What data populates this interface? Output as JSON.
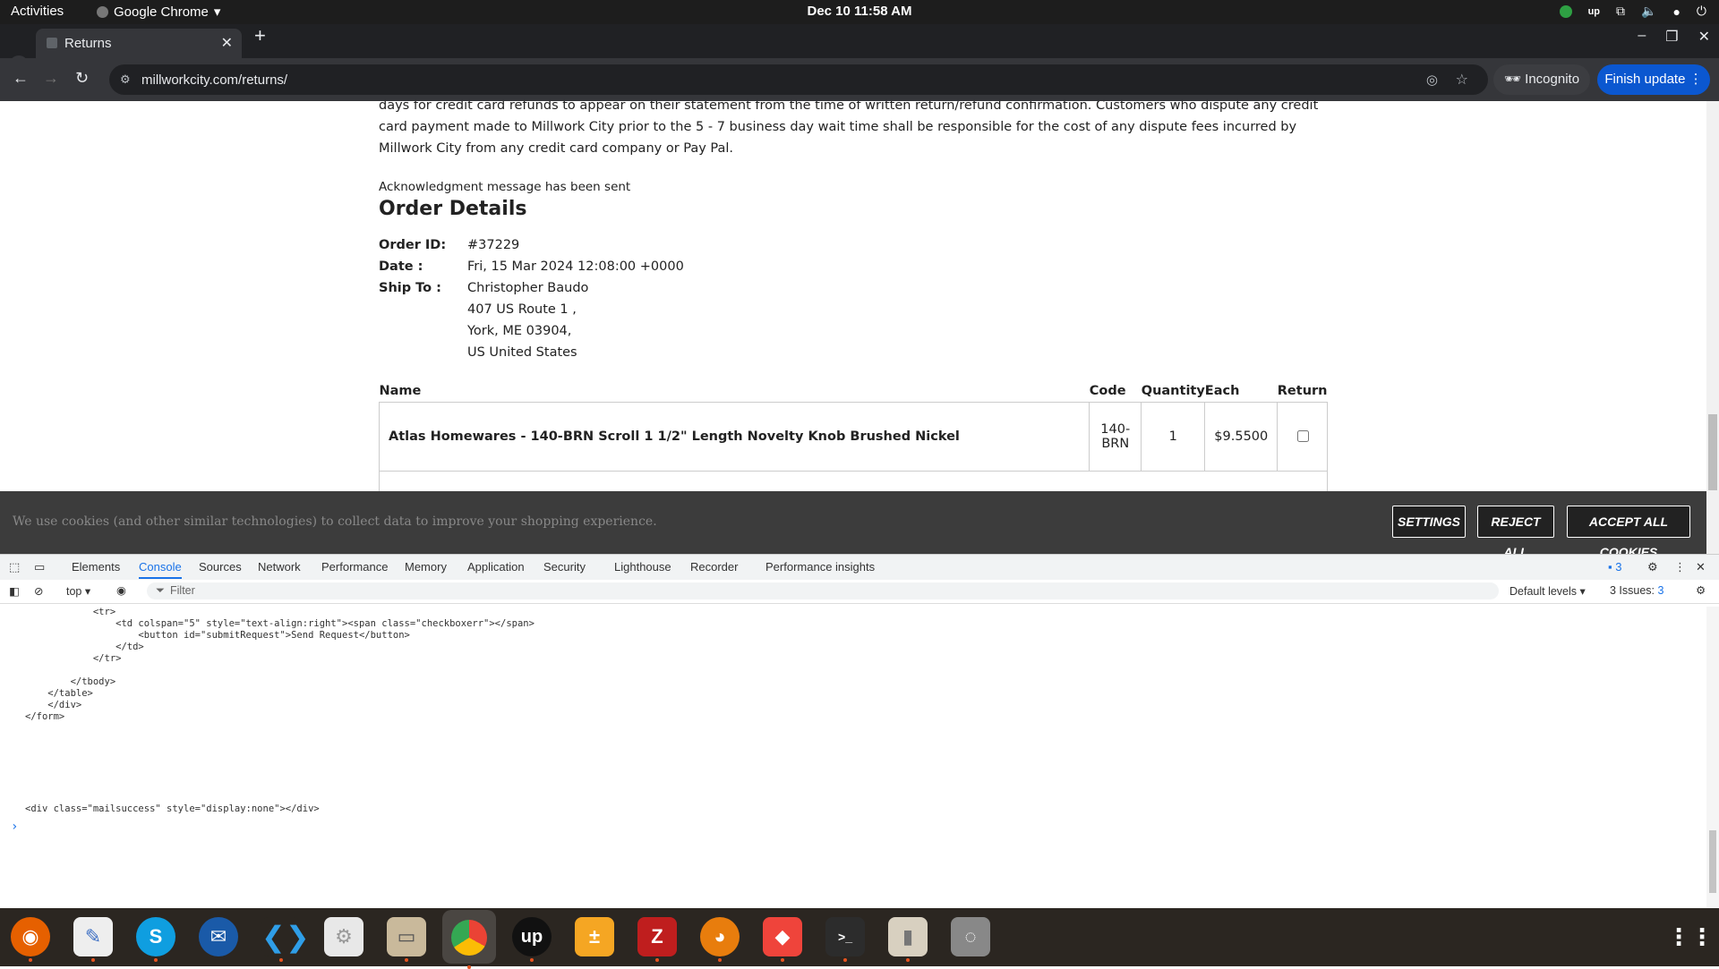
{
  "system": {
    "activities": "Activities",
    "app_name": "Google Chrome",
    "clock": "Dec 10  11:58 AM"
  },
  "browser": {
    "tab_title": "Returns",
    "url": "millworkcity.com/returns/",
    "incognito_label": "Incognito",
    "update_label": "Finish update"
  },
  "page": {
    "policy_text": "days for credit card refunds to appear on their statement from the time of written return/refund confirmation. Customers who dispute any credit card payment made to Millwork City prior to the 5 - 7 business day wait time shall be responsible for the cost of any dispute fees incurred by Millwork City from any credit card company or Pay Pal.",
    "ack_message": "Acknowledgment message has been sent",
    "heading": "Order Details",
    "order_id_label": "Order ID:",
    "order_id": "#37229",
    "date_label": "Date :",
    "date": "Fri, 15 Mar 2024 12:08:00 +0000",
    "ship_label": "Ship To :",
    "ship_name": "Christopher Baudo",
    "ship_addr1": "407 US Route 1 ,",
    "ship_addr2": "York, ME 03904,",
    "ship_country": "US United States",
    "table_headers": [
      "Name",
      "Code",
      "Quantity",
      "Each",
      "Return"
    ],
    "item": {
      "name": "Atlas Homewares - 140-BRN Scroll 1 1/2\" Length Novelty Knob Brushed Nickel",
      "code": "140-BRN",
      "quantity": "1",
      "each": "$9.5500"
    }
  },
  "cookie": {
    "message": "We use cookies (and other similar technologies) to collect data to improve your shopping experience.",
    "settings": "SETTINGS",
    "reject": "REJECT ALL",
    "accept": "ACCEPT ALL COOKIES"
  },
  "devtools": {
    "tabs": [
      "Elements",
      "Console",
      "Sources",
      "Network",
      "Performance",
      "Memory",
      "Application",
      "Security",
      "Lighthouse",
      "Recorder",
      "Performance insights"
    ],
    "active_tab": "Console",
    "context": "top",
    "filter_placeholder": "Filter",
    "levels": "Default levels",
    "issues": "3 Issues:",
    "issues_count": "3",
    "badge_count": "3",
    "console_code": "            <tr>\n                <td colspan=\"5\" style=\"text-align:right\"><span class=\"checkboxerr\"></span>\n                    <button id=\"submitRequest\">Send Request</button>\n                </td>\n            </tr>\n\n        </tbody>\n    </table>\n    </div>\n</form>",
    "console_line2": "<div class=\"mailsuccess\" style=\"display:none\"></div>",
    "prompt": "›"
  },
  "colors": {
    "chrome_dark": "#202124",
    "update_blue": "#0b57d0",
    "devtools_accent": "#1a73e8",
    "cookie_bg": "#3c3c3c"
  },
  "dock_icons": [
    "firefox-icon",
    "text-editor-icon",
    "skype-icon",
    "thunderbird-icon",
    "vscode-icon",
    "settings-icon",
    "files-icon",
    "chrome-icon",
    "upwork-icon",
    "calculator-icon",
    "filezilla-icon",
    "blender-icon",
    "anydesk-icon",
    "terminal-icon",
    "archive-icon",
    "disk-icon",
    "app-grid-icon"
  ]
}
